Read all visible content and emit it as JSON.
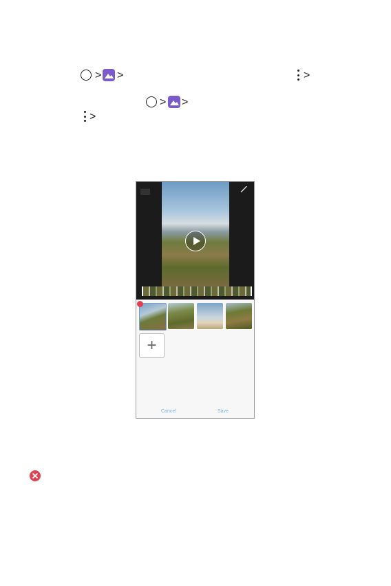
{
  "icons": {
    "home_circle": "circle-icon",
    "gallery": "gallery-icon",
    "more": "more-options-icon",
    "chevron": "chevron-right-icon",
    "delete": "delete-icon"
  },
  "glyphs": {
    "chevron": ">",
    "plus": "+"
  },
  "phone": {
    "buttons": {
      "cancel": "Cancel",
      "save": "Save"
    },
    "thumbnail_count": 4
  },
  "colors": {
    "gallery_accent": "#7b5bc9",
    "delete_red": "#e04050",
    "button_text": "#79b4e6"
  }
}
